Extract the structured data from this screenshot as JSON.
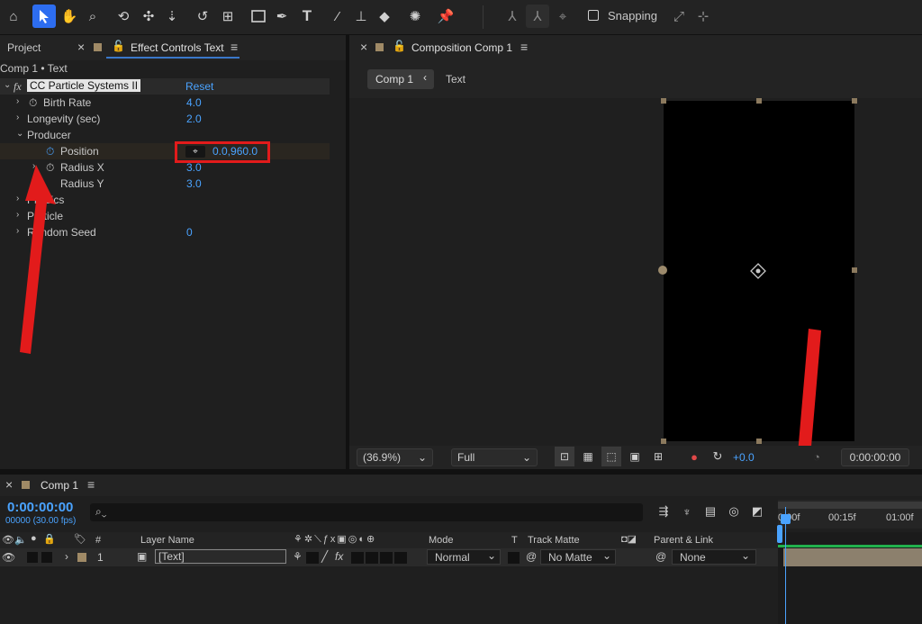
{
  "toolbar": {
    "icons": [
      "home-icon",
      "selection-tool-icon",
      "hand-tool-icon",
      "zoom-tool-icon",
      "orbit-camera-icon",
      "pan-camera-icon",
      "dolly-camera-icon",
      "rotation-tool-icon",
      "pan-behind-icon",
      "rectangle-tool-icon",
      "pen-tool-icon",
      "type-tool-icon",
      "brush-tool-icon",
      "clone-stamp-icon",
      "eraser-tool-icon",
      "roto-brush-icon",
      "puppet-pin-icon",
      "axis-local-icon",
      "axis-world-icon",
      "axis-view-icon"
    ],
    "snapping_label": "Snapping"
  },
  "left_panel": {
    "tab_project": "Project",
    "tab_effect_controls": "Effect Controls Text",
    "breadcrumb": "Comp 1 • Text",
    "effect_name": "CC Particle Systems II",
    "reset_label": "Reset",
    "properties": [
      {
        "label": "Birth Rate",
        "value": "4.0"
      },
      {
        "label": "Longevity (sec)",
        "value": "2.0"
      },
      {
        "label": "Producer",
        "value": ""
      },
      {
        "label": "Position",
        "value": "0.0,960.0"
      },
      {
        "label": "Radius X",
        "value": "3.0"
      },
      {
        "label": "Radius Y",
        "value": "3.0"
      },
      {
        "label": "Physics",
        "value": ""
      },
      {
        "label": "Particle",
        "value": ""
      },
      {
        "label": "Random Seed",
        "value": "0"
      }
    ]
  },
  "comp_panel": {
    "tab_title": "Composition Comp 1",
    "breadcrumb_comp": "Comp 1",
    "breadcrumb_layer": "Text",
    "zoom_value": "(36.9%)",
    "resolution_value": "Full",
    "exposure_value": "+0.0",
    "timecode": "0:00:00:00"
  },
  "timeline": {
    "tab_title": "Comp 1",
    "timecode": "0:00:00:00",
    "frame_info": "00000 (30.00 fps)",
    "search_placeholder": "",
    "ruler": [
      "0:00f",
      "00:15f",
      "01:00f"
    ],
    "col_layer_name": "Layer Name",
    "col_mode": "Mode",
    "col_t": "T",
    "col_track_matte": "Track Matte",
    "col_parent": "Parent & Link",
    "col_hash": "#",
    "layer": {
      "number": "1",
      "name": "[Text]",
      "mode": "Normal",
      "track_matte": "No Matte",
      "parent": "None"
    }
  },
  "colors": {
    "accent": "#2d6df0",
    "timecode_blue": "#4aa3ff",
    "highlight_red": "#e21b1b"
  }
}
